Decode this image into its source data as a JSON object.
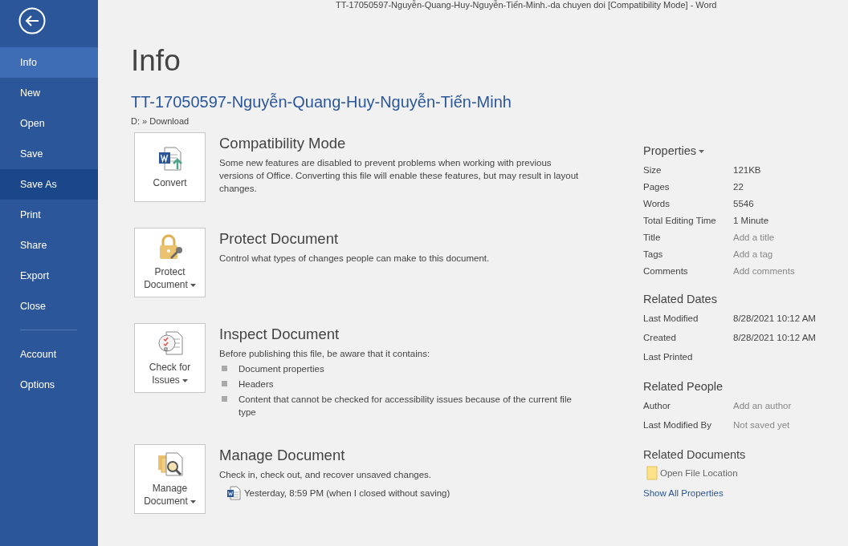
{
  "window": {
    "title": "TT-17050597-Nguyễn-Quang-Huy-Nguyễn-Tiến-Minh.-da chuyen doi [Compatibility Mode] - Word"
  },
  "sidebar": {
    "items": [
      {
        "label": "Info",
        "selected": true,
        "hovered": false
      },
      {
        "label": "New",
        "selected": false,
        "hovered": false
      },
      {
        "label": "Open",
        "selected": false,
        "hovered": false
      },
      {
        "label": "Save",
        "selected": false,
        "hovered": false
      },
      {
        "label": "Save As",
        "selected": false,
        "hovered": true
      },
      {
        "label": "Print",
        "selected": false,
        "hovered": false
      },
      {
        "label": "Share",
        "selected": false,
        "hovered": false
      },
      {
        "label": "Export",
        "selected": false,
        "hovered": false
      },
      {
        "label": "Close",
        "selected": false,
        "hovered": false
      }
    ],
    "footer_items": [
      {
        "label": "Account",
        "selected": false,
        "hovered": false
      },
      {
        "label": "Options",
        "selected": false,
        "hovered": false
      }
    ]
  },
  "page": {
    "heading": "Info",
    "file_name": "TT-17050597-Nguyễn-Quang-Huy-Nguyễn-Tiến-Minh",
    "path": "D: » Download"
  },
  "sections": [
    {
      "kind": "convert",
      "button": [
        "Convert"
      ],
      "dropdown": false,
      "title": "Compatibility Mode",
      "text": "Some new features are disabled to prevent problems when working with previous versions of Office. Converting this file will enable these features, but may result in layout changes."
    },
    {
      "kind": "protect",
      "button": [
        "Protect",
        "Document"
      ],
      "dropdown": true,
      "title": "Protect Document",
      "text": "Control what types of changes people can make to this document."
    },
    {
      "kind": "inspect",
      "button": [
        "Check for",
        "Issues"
      ],
      "dropdown": true,
      "title": "Inspect Document",
      "text": "Before publishing this file, be aware that it contains:",
      "bullets": [
        "Document properties",
        "Headers",
        "Content that cannot be checked for accessibility issues because of the current file type"
      ]
    },
    {
      "kind": "manage",
      "button": [
        "Manage",
        "Document"
      ],
      "dropdown": true,
      "title": "Manage Document",
      "text": "Check in, check out, and recover unsaved changes.",
      "versions": [
        "Yesterday, 8:59 PM (when I closed without saving)"
      ]
    }
  ],
  "properties": {
    "title": "Properties",
    "rows": [
      {
        "label": "Size",
        "value": "121KB",
        "empty": false
      },
      {
        "label": "Pages",
        "value": "22",
        "empty": false
      },
      {
        "label": "Words",
        "value": "5546",
        "empty": false
      },
      {
        "label": "Total Editing Time",
        "value": "1 Minute",
        "empty": false
      },
      {
        "label": "Title",
        "value": "Add a title",
        "empty": true
      },
      {
        "label": "Tags",
        "value": "Add a tag",
        "empty": true
      },
      {
        "label": "Comments",
        "value": "Add comments",
        "empty": true
      }
    ]
  },
  "related_dates": {
    "title": "Related Dates",
    "rows": [
      {
        "label": "Last Modified",
        "value": "8/28/2021 10:12 AM"
      },
      {
        "label": "Created",
        "value": "8/28/2021 10:12 AM"
      },
      {
        "label": "Last Printed"
      }
    ]
  },
  "related_people": {
    "title": "Related People",
    "rows": [
      {
        "label": "Author",
        "value": "Add an author"
      },
      {
        "label": "Last Modified By",
        "value": "Not saved yet"
      }
    ]
  },
  "related_documents": {
    "title": "Related Documents",
    "link": "Open File Location"
  },
  "show_all": "Show All Properties"
}
